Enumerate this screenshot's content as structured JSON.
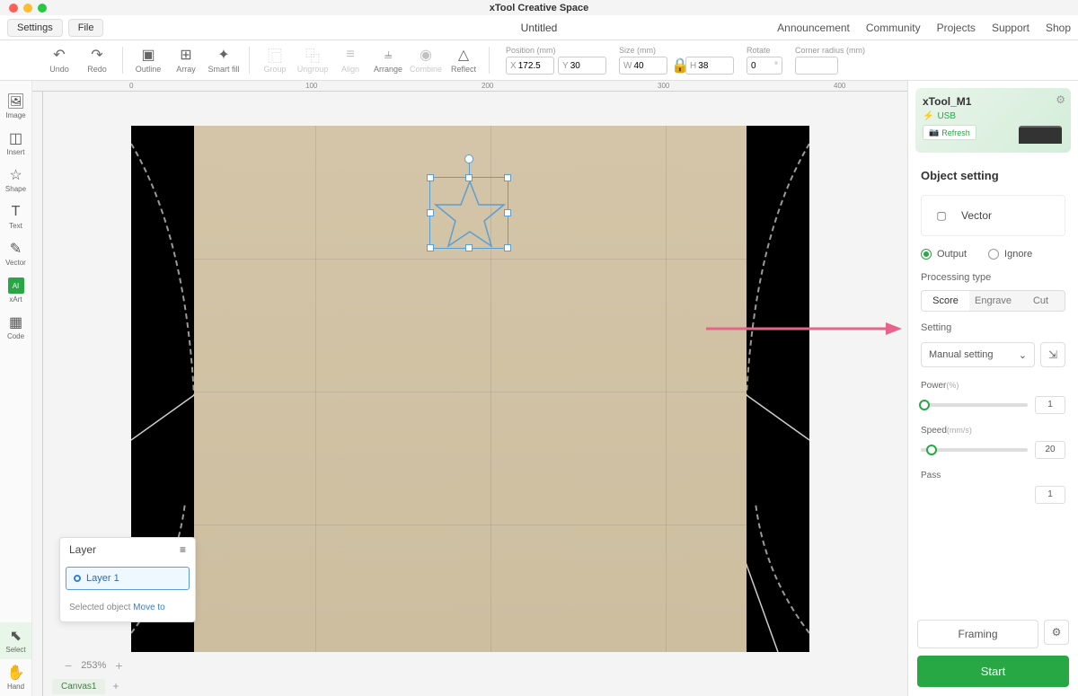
{
  "app": {
    "title": "xTool Creative Space"
  },
  "menubar": {
    "settings": "Settings",
    "file": "File",
    "doc_title": "Untitled",
    "links": [
      "Announcement",
      "Community",
      "Projects",
      "Support",
      "Shop"
    ]
  },
  "toolbar": {
    "undo": "Undo",
    "redo": "Redo",
    "outline": "Outline",
    "array": "Array",
    "smartfill": "Smart fill",
    "group": "Group",
    "ungroup": "Ungroup",
    "align": "Align",
    "arrange": "Arrange",
    "combine": "Combine",
    "reflect": "Reflect",
    "pos_label": "Position (mm)",
    "pos_x": "172.5",
    "pos_y": "30",
    "size_label": "Size (mm)",
    "size_w": "40",
    "size_h": "38",
    "rotate_label": "Rotate",
    "rotate_val": "0",
    "corner_label": "Corner radius (mm)",
    "corner_val": ""
  },
  "sidebar": {
    "items": [
      {
        "label": "Image"
      },
      {
        "label": "Insert"
      },
      {
        "label": "Shape"
      },
      {
        "label": "Text"
      },
      {
        "label": "Vector"
      },
      {
        "label": "xArt"
      },
      {
        "label": "Code"
      }
    ],
    "select": "Select",
    "hand": "Hand"
  },
  "ruler": {
    "m0": "0",
    "m100": "100",
    "m200": "200",
    "m300": "300",
    "m400": "400"
  },
  "layer": {
    "title": "Layer",
    "item1": "Layer 1",
    "selected": "Selected object",
    "moveto": "Move to"
  },
  "zoom": {
    "pct": "253%"
  },
  "tabs": {
    "canvas1": "Canvas1"
  },
  "device": {
    "name": "xTool_M1",
    "conn": "USB",
    "refresh": "Refresh"
  },
  "right": {
    "section": "Object setting",
    "type": "Vector",
    "output": "Output",
    "ignore": "Ignore",
    "proc_label": "Processing type",
    "proc_tabs": [
      "Score",
      "Engrave",
      "Cut"
    ],
    "setting_label": "Setting",
    "setting_mode": "Manual setting",
    "power_label": "Power",
    "power_unit": "(%)",
    "power_val": "1",
    "speed_label": "Speed",
    "speed_unit": "(mm/s)",
    "speed_val": "20",
    "pass_label": "Pass",
    "pass_val": "1",
    "framing": "Framing",
    "start": "Start"
  }
}
